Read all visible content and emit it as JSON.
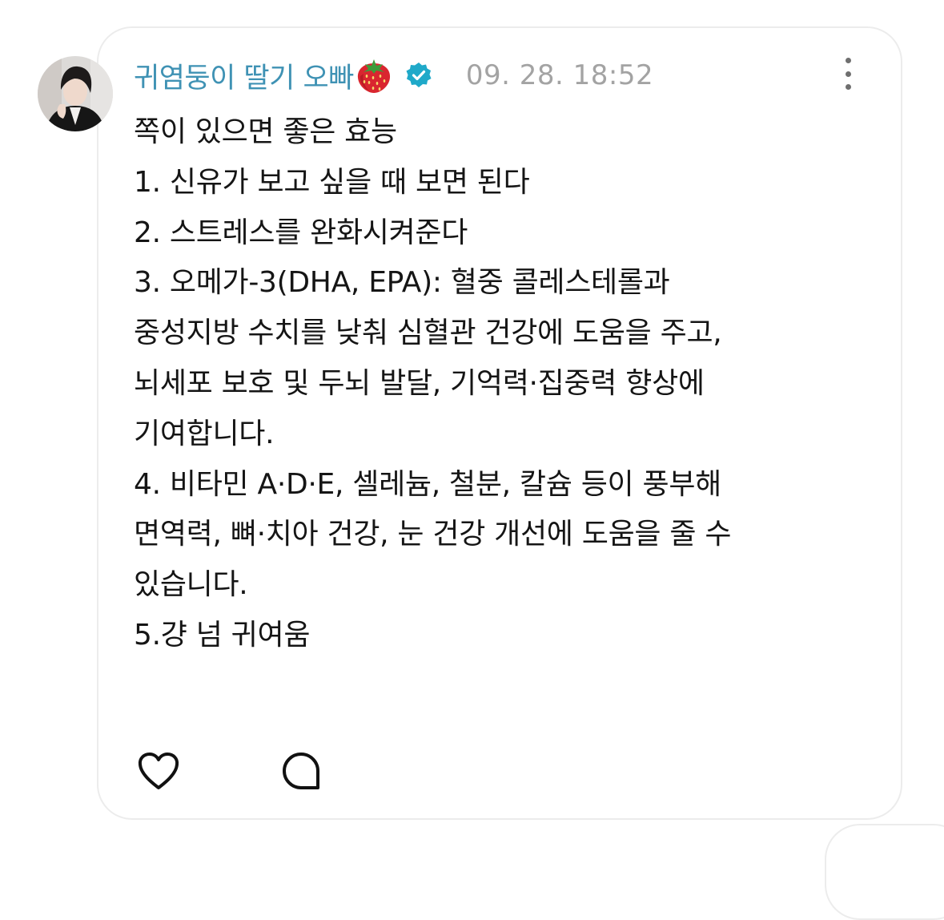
{
  "post": {
    "author": {
      "name": "귀염둥이 딸기 오빠",
      "name_emoji": "strawberry-emoji",
      "verified": true,
      "verified_badge_color": "#1fa9c9",
      "name_color": "#3f92b4"
    },
    "timestamp": "09. 28. 18:52",
    "more_icon": "more-vertical-icon",
    "lines": [
      "쪽이 있으면 좋은 효능",
      "1. 신유가 보고 싶을 때 보면 된다",
      "2. 스트레스를 완화시켜준다",
      "3. 오메가-3(DHA, EPA): 혈중 콜레스테롤과",
      "중성지방 수치를 낮춰 심혈관 건강에 도움을 주고,",
      "뇌세포 보호 및 두뇌 발달, 기억력·집중력 향상에",
      "기여합니다.",
      "4. 비타민 A·D·E, 셀레늄, 철분, 칼슘 등이 풍부해",
      "면역력, 뼈·치아 건강, 눈 건강 개선에 도움을 줄 수",
      "있습니다.",
      "5.걍 넘 귀여움"
    ],
    "actions": {
      "like_icon": "heart-icon",
      "reply_icon": "comment-bubble-icon"
    }
  }
}
